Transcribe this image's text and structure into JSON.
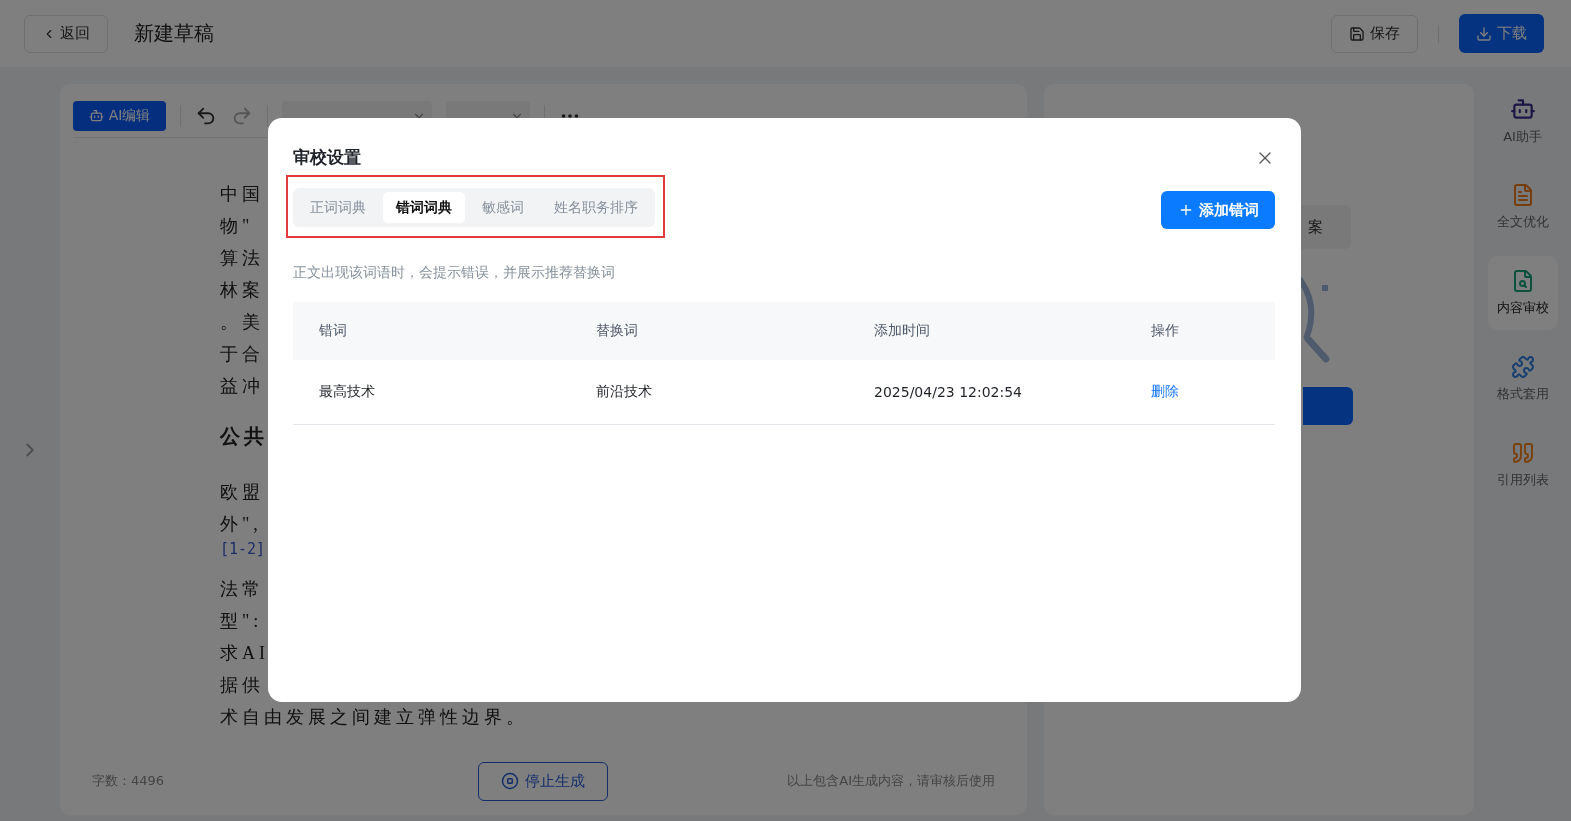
{
  "header": {
    "back": "返回",
    "title": "新建草稿",
    "save": "保存",
    "download": "下载"
  },
  "toolbar": {
    "ai_edit": "AI编辑"
  },
  "document": {
    "blocks": [
      {
        "kind": "paragraph",
        "lines": [
          "中国",
          "物\"",
          "算法",
          "林案",
          "。美",
          "于合",
          "益冲"
        ]
      },
      {
        "kind": "heading",
        "text": "公共"
      },
      {
        "kind": "paragraph",
        "lines": [
          "欧盟",
          "外\","
        ]
      },
      {
        "kind": "citation",
        "text": "[1-2]"
      },
      {
        "kind": "paragraph",
        "lines": [
          "法常",
          "型\":",
          "求AI",
          "据供",
          "术自由发展之间建立弹性边界。"
        ]
      }
    ]
  },
  "footer": {
    "word_count": "字数：4496",
    "stop": "停止生成",
    "note": "以上包含AI生成内容，请审核后使用"
  },
  "review_panel": {
    "button_fragment": "案"
  },
  "sidebar": [
    {
      "label": "AI助手",
      "kind": "robot",
      "selected": false
    },
    {
      "label": "全文优化",
      "kind": "optimize",
      "selected": false
    },
    {
      "label": "内容审校",
      "kind": "review",
      "selected": true
    },
    {
      "label": "格式套用",
      "kind": "format",
      "selected": false
    },
    {
      "label": "引用列表",
      "kind": "quote",
      "selected": false
    }
  ],
  "dialog": {
    "title": "审校设置",
    "tabs": [
      {
        "label": "正词词典",
        "selected": false
      },
      {
        "label": "错词词典",
        "selected": true
      },
      {
        "label": "敏感词",
        "selected": false
      },
      {
        "label": "姓名职务排序",
        "selected": false
      }
    ],
    "add_button": "添加错词",
    "description": "正文出现该词语时，会提示错误，并展示推荐替换词",
    "table": {
      "columns": [
        "错词",
        "替换词",
        "添加时间",
        "操作"
      ],
      "rows": [
        {
          "wrong": "最高技术",
          "replacement": "前沿技术",
          "added": "2025/04/23 12:02:54",
          "action": "删除"
        }
      ]
    }
  }
}
